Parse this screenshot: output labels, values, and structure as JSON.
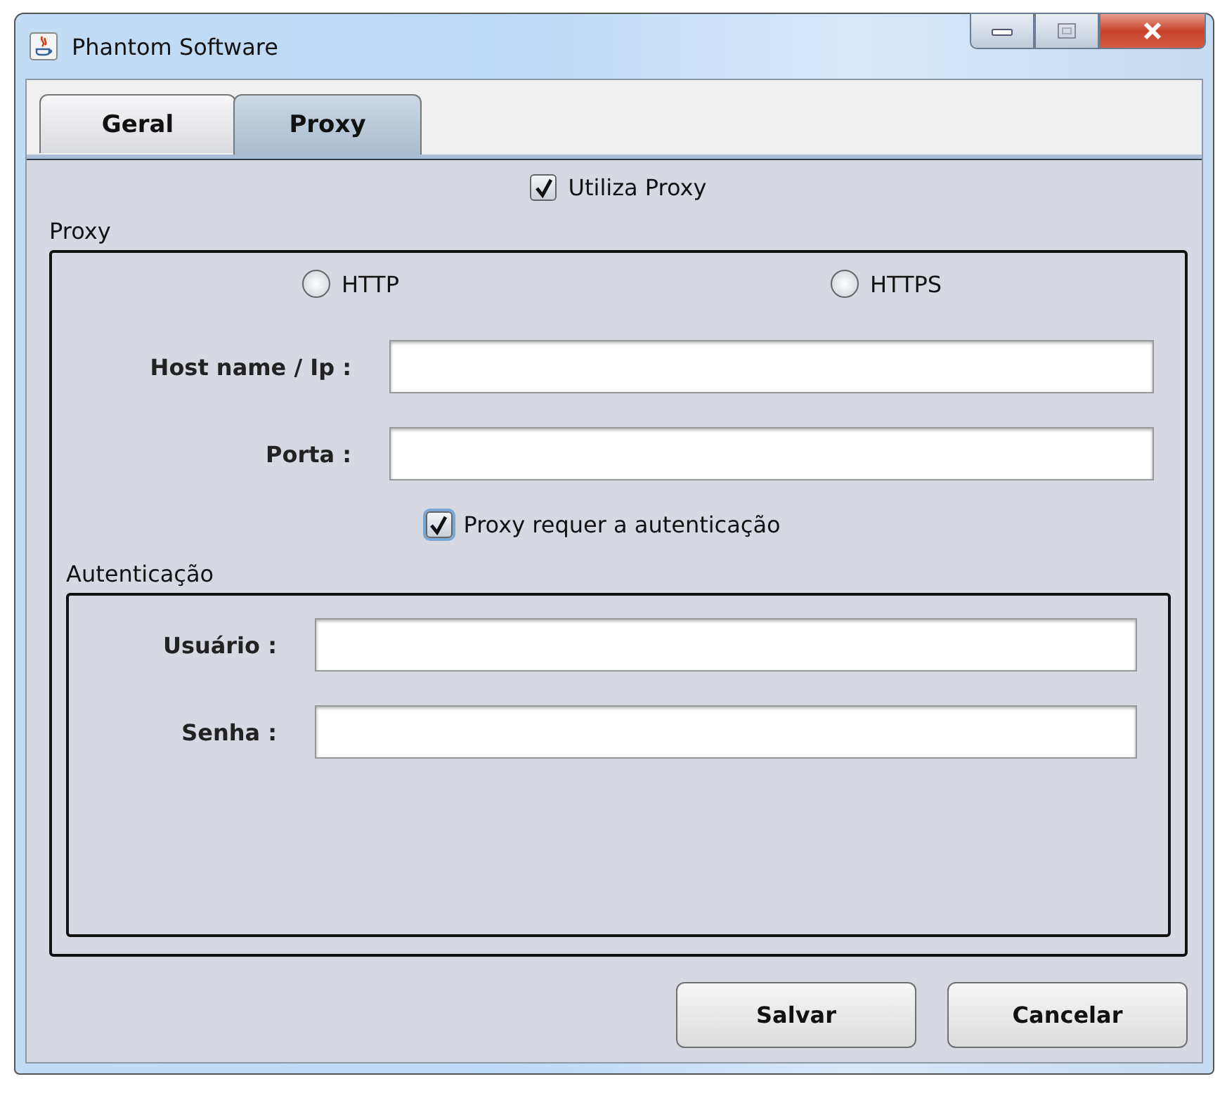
{
  "window": {
    "title": "Phantom Software"
  },
  "tabs": [
    {
      "label": "Geral",
      "selected": false
    },
    {
      "label": "Proxy",
      "selected": true
    }
  ],
  "use_proxy": {
    "label": "Utiliza Proxy",
    "checked": true
  },
  "proxy_group": {
    "title": "Proxy",
    "protocols": [
      {
        "label": "HTTP",
        "selected": false
      },
      {
        "label": "HTTPS",
        "selected": false
      }
    ],
    "fields": [
      {
        "label": "Host name / Ip :"
      },
      {
        "label": "Porta :"
      }
    ],
    "auth_required": {
      "label": "Proxy requer a autenticação",
      "checked": true,
      "focused": true
    },
    "auth_group": {
      "title": "Autenticação",
      "fields": [
        {
          "label": "Usuário :"
        },
        {
          "label": "Senha :"
        }
      ]
    }
  },
  "buttons": [
    "Salvar",
    "Cancelar"
  ]
}
